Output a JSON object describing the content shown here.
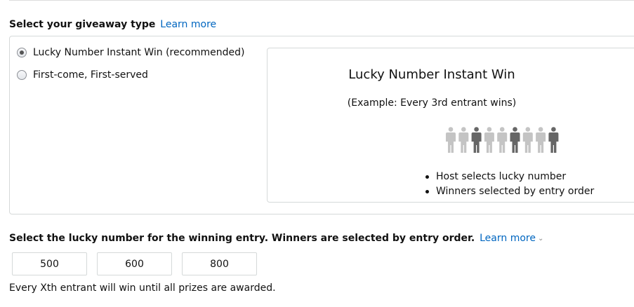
{
  "giveaway_type": {
    "heading": "Select your giveaway type",
    "learn_more": "Learn more",
    "options": [
      {
        "label": "Lucky Number Instant Win (recommended)",
        "selected": true
      },
      {
        "label": "First-come, First-served",
        "selected": false
      }
    ]
  },
  "info_card": {
    "title": "Lucky Number Instant Win",
    "example": "(Example: Every 3rd entrant wins)",
    "icon": "people-row-icon",
    "winner_pattern": [
      false,
      false,
      true,
      false,
      false,
      true,
      false,
      false,
      true
    ],
    "colors": {
      "entrant": "#c4c4c4",
      "winner": "#666666"
    },
    "bullets": [
      "Host selects lucky number",
      "Winners selected by entry order"
    ]
  },
  "lucky_number": {
    "heading": "Select the lucky number for the winning entry. Winners are selected by entry order.",
    "learn_more": "Learn more",
    "options": [
      "500",
      "600",
      "800"
    ],
    "note": "Every Xth entrant will win until all prizes are awarded."
  },
  "colors": {
    "link": "#0066c0",
    "border": "#d5d9d9",
    "text": "#111111"
  }
}
